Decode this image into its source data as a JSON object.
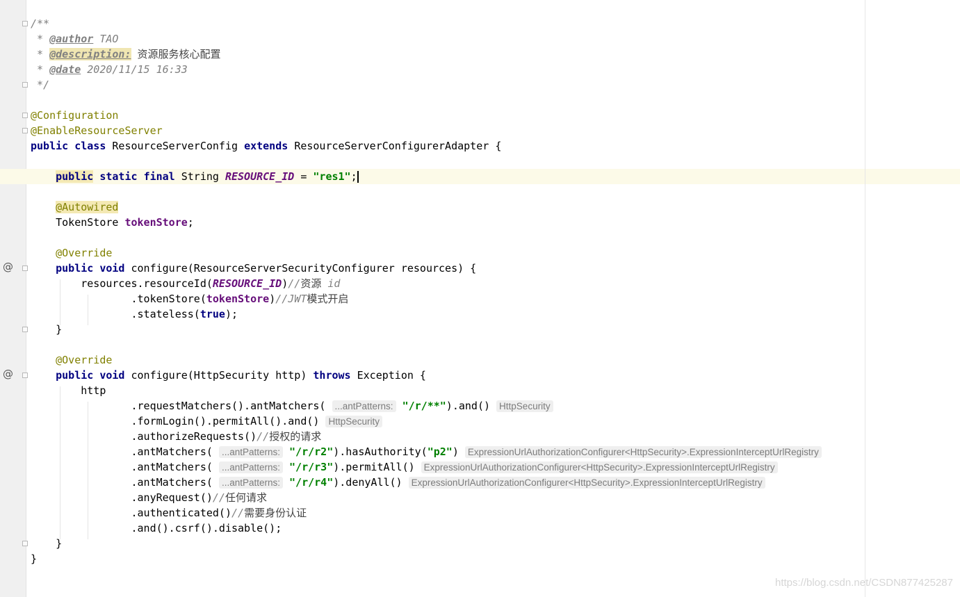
{
  "doc": {
    "open": "/**",
    "star": " * ",
    "author_tag": "@author",
    "author": "TAO",
    "desc_tag": "@description:",
    "desc": "资源服务核心配置",
    "date_tag": "@date",
    "date": "2020/11/15 16:33",
    "close": " */"
  },
  "cls": {
    "ann1": "@Configuration",
    "ann2": "@EnableResourceServer",
    "kw_public": "public",
    "kw_class": "class",
    "name": "ResourceServerConfig",
    "kw_extends": "extends",
    "parent": "ResourceServerConfigurerAdapter",
    "open_brace": "{",
    "close_brace": "}"
  },
  "field": {
    "kw_public": "public",
    "kw_static": "static",
    "kw_final": "final",
    "type": "String",
    "name": "RESOURCE_ID",
    "eq": "=",
    "value": "\"res1\"",
    "semi": ";"
  },
  "autowired": {
    "ann": "@Autowired",
    "type": "TokenStore",
    "name": "tokenStore",
    "semi": ";"
  },
  "m1": {
    "ann": "@Override",
    "kw_public": "public",
    "kw_void": "void",
    "sig_a": "configure(ResourceServerSecurityConfigurer resources) {",
    "l1_a": "resources.resourceId(",
    "l1_field": "RESOURCE_ID",
    "l1_b": ")",
    "l1_comment_slash": "//",
    "l1_comment_cjk": "资源",
    "l1_comment_rest": " id",
    "l2_a": ".tokenStore(",
    "l2_field": "tokenStore",
    "l2_b": ")",
    "l2_comment_a": "//JWT",
    "l2_comment_cjk": "模式开启",
    "l3_a": ".stateless(",
    "l3_kw": "true",
    "l3_b": ");",
    "close": "}"
  },
  "m2": {
    "ann": "@Override",
    "kw_public": "public",
    "kw_void": "void",
    "sig_a": "configure(HttpSecurity http)",
    "kw_throws": "throws",
    "sig_b": "Exception {",
    "http": "http",
    "r1_a": ".requestMatchers().antMatchers(",
    "r1_hint": "...antPatterns:",
    "r1_str": "\"/r/**\"",
    "r1_b": ").and()",
    "r1_type": "HttpSecurity",
    "r2_a": ".formLogin().permitAll().and()",
    "r2_type": "HttpSecurity",
    "r3_a": ".authorizeRequests()",
    "r3_comment_slash": "//",
    "r3_comment_cjk": "授权的请求",
    "r4_a": ".antMatchers(",
    "r4_hint": "...antPatterns:",
    "r4_str": "\"/r/r2\"",
    "r4_b": ").hasAuthority(",
    "r4_str2": "\"p2\"",
    "r4_c": ")",
    "r4_type": "ExpressionUrlAuthorizationConfigurer<HttpSecurity>.ExpressionInterceptUrlRegistry",
    "r5_a": ".antMatchers(",
    "r5_hint": "...antPatterns:",
    "r5_str": "\"/r/r3\"",
    "r5_b": ").permitAll()",
    "r5_type": "ExpressionUrlAuthorizationConfigurer<HttpSecurity>.ExpressionInterceptUrlRegistry",
    "r6_a": ".antMatchers(",
    "r6_hint": "...antPatterns:",
    "r6_str": "\"/r/r4\"",
    "r6_b": ").denyAll()",
    "r6_type": "ExpressionUrlAuthorizationConfigurer<HttpSecurity>.ExpressionInterceptUrlRegistry",
    "r7_a": ".anyRequest()",
    "r7_comment_slash": "//",
    "r7_comment_cjk": "任何请求",
    "r8_a": ".authenticated()",
    "r8_comment_slash": "//",
    "r8_comment_cjk": "需要身份认证",
    "r9_a": ".and().csrf().disable();",
    "close": "}"
  },
  "gutter": {
    "override_marker": "@"
  },
  "watermark": "https://blog.csdn.net/CSDN877425287"
}
